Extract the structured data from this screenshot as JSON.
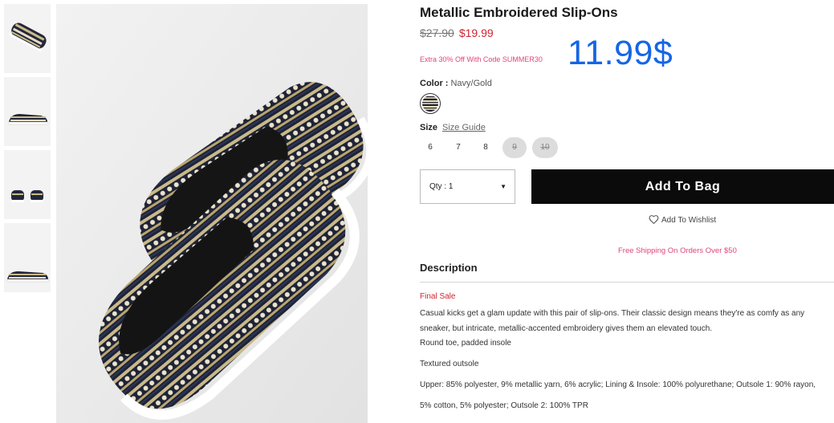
{
  "product": {
    "title": "Metallic Embroidered Slip-Ons",
    "original_price": "$27.90",
    "sale_price": "$19.99",
    "promo_text": "Extra 30% Off With Code SUMMER30",
    "overlay_price": "11.99$",
    "color_label": "Color :",
    "color_value": "Navy/Gold",
    "size_label": "Size",
    "size_guide_label": "Size Guide",
    "sizes": [
      {
        "label": "6",
        "available": true
      },
      {
        "label": "7",
        "available": true
      },
      {
        "label": "8",
        "available": true
      },
      {
        "label": "9",
        "available": false
      },
      {
        "label": "10",
        "available": false
      }
    ],
    "qty_label": "Qty : 1",
    "add_to_bag_label": "Add To Bag",
    "wishlist_label": "Add To Wishlist",
    "shipping_text": "Free Shipping On Orders Over $50"
  },
  "description": {
    "heading": "Description",
    "final_sale": "Final Sale",
    "summary": "Casual kicks get a glam update with this pair of slip-ons. Their classic design means they're as comfy as any sneaker, but intricate, metallic-accented embroidery gives them an elevated touch.",
    "feature_1": "Round toe, padded insole",
    "feature_2": "Textured outsole",
    "materials": "Upper: 85% polyester, 9% metallic yarn, 6% acrylic; Lining & Insole: 100% polyurethane; Outsole 1: 90% rayon, 5% cotton, 5% polyester; Outsole 2: 100% TPR"
  },
  "colors": {
    "sale_red": "#d0232f",
    "promo_pink": "#e0457b",
    "overlay_blue": "#1565e6",
    "button_black": "#0b0b0b"
  }
}
